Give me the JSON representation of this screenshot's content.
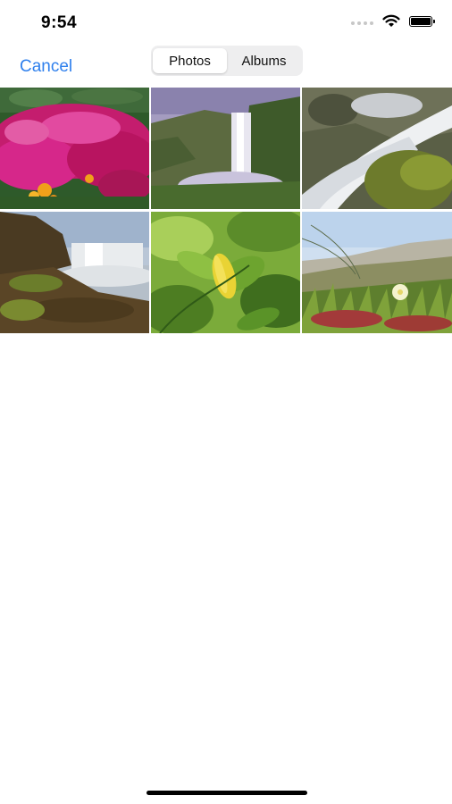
{
  "status_bar": {
    "time": "9:54"
  },
  "nav": {
    "cancel_label": "Cancel",
    "segments": [
      {
        "label": "Photos",
        "selected": true
      },
      {
        "label": "Albums",
        "selected": false
      }
    ]
  },
  "photos": [
    {
      "subject": "magenta flower field"
    },
    {
      "subject": "waterfall in misty valley"
    },
    {
      "subject": "cascading stream over mossy rocks"
    },
    {
      "subject": "waterfall with rocky cliff"
    },
    {
      "subject": "green leaves with yellow leaf"
    },
    {
      "subject": "coastal grass with flower"
    }
  ],
  "colors": {
    "accent": "#2f80ed",
    "segment_bg": "#eeeeef"
  }
}
